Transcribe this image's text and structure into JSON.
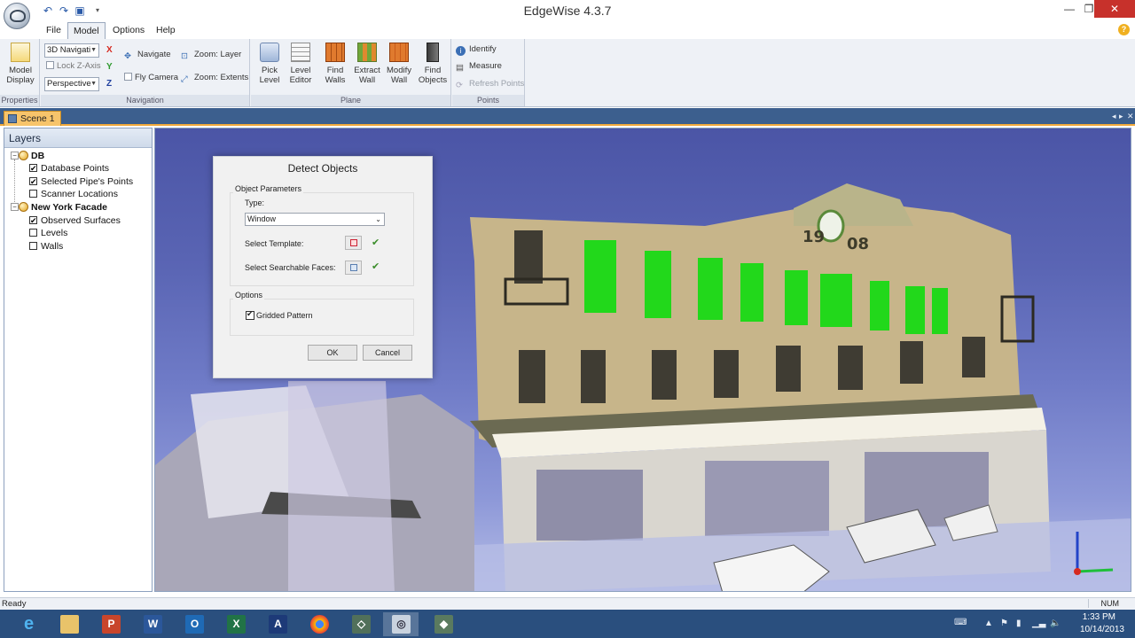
{
  "window": {
    "title": "EdgeWise 4.3.7",
    "minimize": "—",
    "restore": "❐",
    "close": "✕"
  },
  "menu": {
    "tabs": [
      "File",
      "Model",
      "Options",
      "Help"
    ],
    "active": "Model"
  },
  "ribbon": {
    "properties": {
      "label": "Properties",
      "model_display": "Model Display"
    },
    "navigation": {
      "label": "Navigation",
      "mode_combo": "3D Navigati",
      "lock_z": "Lock Z-Axis",
      "projection_combo": "Perspective",
      "axes": [
        "X",
        "Y",
        "Z"
      ],
      "navigate": "Navigate",
      "fly_camera": "Fly Camera",
      "zoom_layer": "Zoom: Layer",
      "zoom_extents": "Zoom: Extents"
    },
    "plane": {
      "label": "Plane",
      "buttons": [
        {
          "line1": "Pick",
          "line2": "Level"
        },
        {
          "line1": "Level",
          "line2": "Editor"
        },
        {
          "line1": "Find",
          "line2": "Walls"
        },
        {
          "line1": "Extract",
          "line2": "Wall"
        },
        {
          "line1": "Modify",
          "line2": "Wall"
        },
        {
          "line1": "Find",
          "line2": "Objects"
        }
      ]
    },
    "points": {
      "label": "Points",
      "identify": "Identify",
      "measure": "Measure",
      "refresh": "Refresh Points"
    }
  },
  "doc_tab": {
    "label": "Scene 1"
  },
  "layers": {
    "title": "Layers",
    "items": [
      {
        "label": "DB",
        "checked": false,
        "kind": "root"
      },
      {
        "label": "Database Points",
        "checked": true,
        "kind": "child"
      },
      {
        "label": "Selected Pipe's Points",
        "checked": true,
        "kind": "child"
      },
      {
        "label": "Scanner Locations",
        "checked": false,
        "kind": "child"
      },
      {
        "label": "New York Facade",
        "checked": false,
        "kind": "root"
      },
      {
        "label": "Observed Surfaces",
        "checked": true,
        "kind": "child"
      },
      {
        "label": "Levels",
        "checked": false,
        "kind": "child"
      },
      {
        "label": "Walls",
        "checked": false,
        "kind": "child"
      }
    ]
  },
  "dialog": {
    "title": "Detect Objects",
    "object_params_label": "Object Parameters",
    "type_label": "Type:",
    "type_value": "Window",
    "select_template_label": "Select Template:",
    "select_faces_label": "Select Searchable Faces:",
    "options_label": "Options",
    "gridded_label": "Gridded Pattern",
    "gridded_checked": true,
    "ok_label": "OK",
    "cancel_label": "Cancel"
  },
  "facade": {
    "year_left": "19",
    "year_right": "08"
  },
  "status": {
    "text": "Ready",
    "num": "NUM"
  },
  "taskbar": {
    "apps": [
      "ie-icon",
      "explorer-icon",
      "powerpoint-icon",
      "word-icon",
      "outlook-icon",
      "excel-icon",
      "app-icon",
      "chrome-icon",
      "app2-icon",
      "edgewise-icon",
      "app3-icon"
    ],
    "time": "1:33 PM",
    "date": "10/14/2013"
  },
  "colors": {
    "accent": "#2a4f7e",
    "tab_orange": "#f7c46b",
    "detected_window": "#22d81b",
    "sky": "#5a65b4"
  }
}
